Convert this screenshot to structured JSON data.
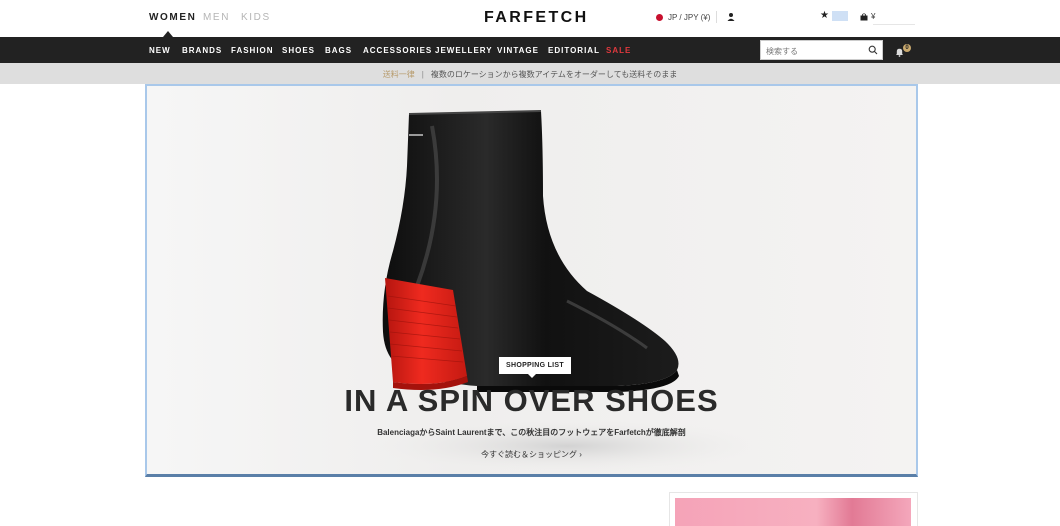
{
  "header": {
    "gender_tabs": [
      "WOMEN",
      "MEN",
      "KIDS"
    ],
    "logo": "FARFETCH",
    "locale": "JP / JPY (¥)",
    "cart_currency": "¥"
  },
  "nav": {
    "items": [
      "NEW",
      "BRANDS",
      "FASHION",
      "SHOES",
      "BAGS",
      "ACCESSORIES",
      "JEWELLERY",
      "VINTAGE",
      "EDITORIAL",
      "SALE"
    ],
    "search_placeholder": "検索する",
    "notification_count": "0"
  },
  "promo": {
    "lead": "送料一律",
    "separator": "|",
    "text": "複数のロケーションから複数アイテムをオーダーしても送料そのまま"
  },
  "hero": {
    "tag": "SHOPPING LIST",
    "headline": "IN A SPIN OVER SHOES",
    "subline": "BalenciagaからSaint Laurentまで、この秋注目のフットウェアをFarfetchが徹底解剖",
    "cta": "今すぐ読む＆ショッピング ›"
  },
  "colors": {
    "nav_bg": "#222222",
    "sale": "#e0393e",
    "promo_bg": "#dedede",
    "promo_accent": "#b79a6a",
    "hero_bg": "#f2f1f0",
    "heel_red": "#e3241c"
  }
}
